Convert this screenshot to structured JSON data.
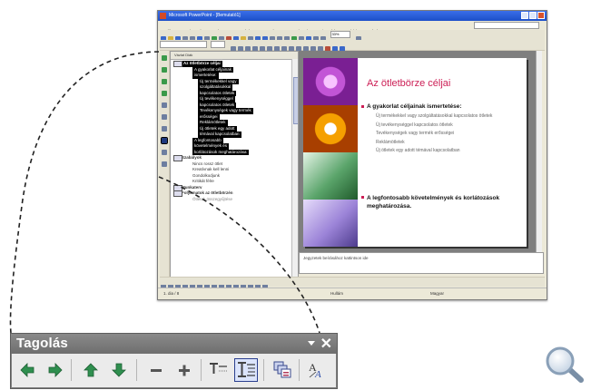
{
  "window": {
    "title": "Microsoft PowerPoint - [Bemutató1]",
    "menu": [
      "Fájl",
      "Szerkesztés",
      "Nézet",
      "Beszúrás",
      "Formátum",
      "Eszközök",
      "Diavetítés",
      "Ablak",
      "Súgó"
    ],
    "zoom": "33%"
  },
  "outline": {
    "tabs": "Vázlat   Diák",
    "lines": [
      {
        "text": "Az ötletbörze céljai",
        "style": "sel-title",
        "indent": 0
      },
      {
        "text": "A gyakorlat céljainak",
        "style": "sel",
        "indent": 2
      },
      {
        "text": "ismertetése:",
        "style": "sel",
        "indent": 2
      },
      {
        "text": "Új termékekkel vagy",
        "style": "sel",
        "indent": 3
      },
      {
        "text": "szolgáltatásokkal",
        "style": "sel",
        "indent": 3
      },
      {
        "text": "kapcsolatos ötletek",
        "style": "sel",
        "indent": 3
      },
      {
        "text": "Új tevékenységgel",
        "style": "sel",
        "indent": 3
      },
      {
        "text": "kapcsolatos ötletek",
        "style": "sel",
        "indent": 3
      },
      {
        "text": "Tevékenységek vagy termék",
        "style": "sel",
        "indent": 3
      },
      {
        "text": "erősségei",
        "style": "sel",
        "indent": 3
      },
      {
        "text": "Reklámötletek",
        "style": "sel",
        "indent": 3
      },
      {
        "text": "Új ötletek egy adott",
        "style": "sel",
        "indent": 3
      },
      {
        "text": "témával kapcsolatban",
        "style": "sel",
        "indent": 3
      },
      {
        "text": "A legfontosabb",
        "style": "sel",
        "indent": 2
      },
      {
        "text": "követelmények és",
        "style": "sel",
        "indent": 2
      },
      {
        "text": "korlátozások meghatározása",
        "style": "sel",
        "indent": 2
      },
      {
        "text": "Szabályok",
        "style": "title",
        "indent": 0
      },
      {
        "text": "Nincs rossz ötlet",
        "style": "txt",
        "indent": 2
      },
      {
        "text": "Kreatívnak kell lenni",
        "style": "txt",
        "indent": 2
      },
      {
        "text": "Gondolkodjunk",
        "style": "txt",
        "indent": 2
      },
      {
        "text": "Kritikát félre",
        "style": "txt",
        "indent": 2
      },
      {
        "text": "Munkaterv",
        "style": "title",
        "indent": 0
      },
      {
        "text": "Folyamatok az ötletbörzén",
        "style": "title",
        "indent": 0
      },
      {
        "text": "Ötletek összegyűjtése",
        "style": "pale",
        "indent": 2
      }
    ]
  },
  "slide": {
    "title": "Az ötletbörze céljai",
    "bullet1": "A gyakorlat céljainak ismertetése:",
    "subs": [
      "Új termékekkel vagy szolgáltatásokkal kapcsolatos ötletek",
      "Új tevékenységgel kapcsolatos ötletek",
      "Tevékenységek vagy termék erősségei",
      "Reklámötletek",
      "Új ötletek egy adott témával kapcsolatban"
    ],
    "bullet2": "A legfontosabb követelmények és korlátozások meghatározása.",
    "accent": "#cc1e55"
  },
  "notes": "Jegyzetek beírásához kattintson ide",
  "status": {
    "slide": "1. dia / 8",
    "design": "Hullám",
    "language": "Magyar"
  },
  "toolbar": {
    "title": "Tagolás",
    "buttons": [
      {
        "name": "promote-button",
        "icon": "left-arrow-icon"
      },
      {
        "name": "demote-button",
        "icon": "right-arrow-icon"
      },
      {
        "name": "move-up-button",
        "icon": "up-arrow-icon"
      },
      {
        "name": "move-down-button",
        "icon": "down-arrow-icon"
      },
      {
        "name": "collapse-button",
        "icon": "minus-icon"
      },
      {
        "name": "expand-button",
        "icon": "plus-icon"
      },
      {
        "name": "collapse-all-button",
        "icon": "collapse-all-icon"
      },
      {
        "name": "expand-all-button",
        "icon": "expand-all-icon"
      },
      {
        "name": "summary-slide-button",
        "icon": "summary-slide-icon"
      },
      {
        "name": "show-formatting-button",
        "icon": "show-formatting-icon"
      }
    ],
    "selected_button": "expand-all-button",
    "arrow_color": "#2f8f4f"
  }
}
